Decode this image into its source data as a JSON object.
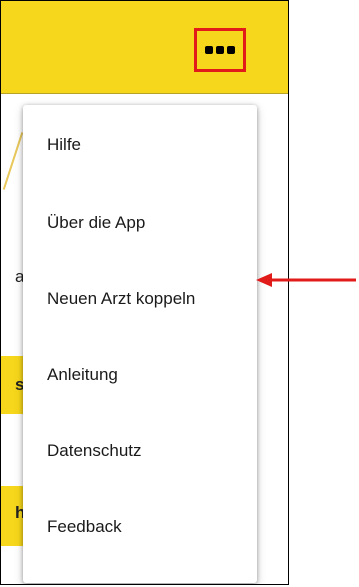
{
  "app_bar": {
    "more_icon": "more-horizontal-icon",
    "accent_color": "#f7d71b",
    "highlight_color": "#e11a1a"
  },
  "background_fragments": [
    "a",
    "s",
    "h"
  ],
  "overflow_menu": {
    "items": [
      {
        "label": "Hilfe"
      },
      {
        "label": "Über die App"
      },
      {
        "label": "Neuen Arzt koppeln",
        "highlighted": true
      },
      {
        "label": "Anleitung"
      },
      {
        "label": "Datenschutz"
      },
      {
        "label": "Feedback"
      }
    ]
  },
  "annotation": {
    "arrow_icon": "arrow-left-icon",
    "color": "#e11a1a"
  }
}
